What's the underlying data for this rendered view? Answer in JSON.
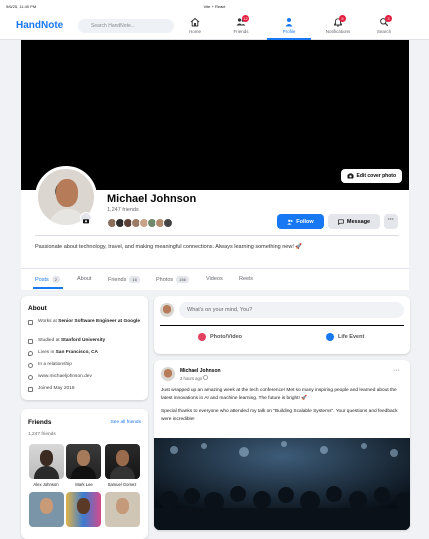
{
  "browser": {
    "time": "9/6/25, 11:40 PM",
    "title": "Vite + React"
  },
  "nav": {
    "logo": "HandNote",
    "search_placeholder": "Search HandNote...",
    "items": [
      {
        "label": "Home",
        "icon": "home-icon"
      },
      {
        "label": "Friends",
        "icon": "friends-icon",
        "badge": "12"
      },
      {
        "label": "Profile",
        "icon": "profile-icon",
        "active": true
      },
      {
        "label": "Notifications",
        "icon": "bell-icon",
        "badge": "5"
      },
      {
        "label": "Search",
        "icon": "search-icon",
        "badge": "3"
      }
    ]
  },
  "cover": {
    "edit_label": "Edit cover photo"
  },
  "profile": {
    "name": "Michael Johnson",
    "friends_count": "1,247 friends",
    "follow_label": "Follow",
    "message_label": "Message",
    "more_label": "···",
    "bio": "Passionate about technology, travel, and making meaningful connections. Always learning something new! 🚀"
  },
  "tabs": [
    {
      "label": "Posts",
      "count": "2",
      "active": true
    },
    {
      "label": "About"
    },
    {
      "label": "Friends",
      "count": "16"
    },
    {
      "label": "Photos",
      "count": "156"
    },
    {
      "label": "Videos"
    },
    {
      "label": "Reels"
    }
  ],
  "about": {
    "title": "About",
    "work_prefix": "Works at ",
    "work": "Senior Software Engineer at Google",
    "study_prefix": "Studied at ",
    "study": "Stanford University",
    "lives_prefix": "Lives in ",
    "lives": "San Francisco, CA",
    "relationship": "In a relationship",
    "website": "www.michaeljohnson.dev",
    "joined": "Joined May 2018"
  },
  "friends_box": {
    "title": "Friends",
    "see_all": "See all friends",
    "count": "1,247 friends",
    "list": [
      {
        "name": "Alex Johnson"
      },
      {
        "name": "Mark Lee"
      },
      {
        "name": "Samuel Gomez"
      }
    ]
  },
  "composer": {
    "placeholder": "What's on your mind, You?",
    "photo_label": "Photo/Video",
    "life_label": "Life Event"
  },
  "post": {
    "author": "Michael Johnson",
    "time": "2 hours ago",
    "paragraph1": "Just wrapped up an amazing week at the tech conference! Met so many inspiring people and learned about the latest innovations in AI and machine learning. The future is bright! 🚀",
    "paragraph2": "Special thanks to everyone who attended my talk on \"Building Scalable Systems\". Your questions and feedback were incredible!"
  },
  "colors": {
    "accent": "#1877f2",
    "badge": "#e41e3f",
    "cover": "#000000"
  }
}
